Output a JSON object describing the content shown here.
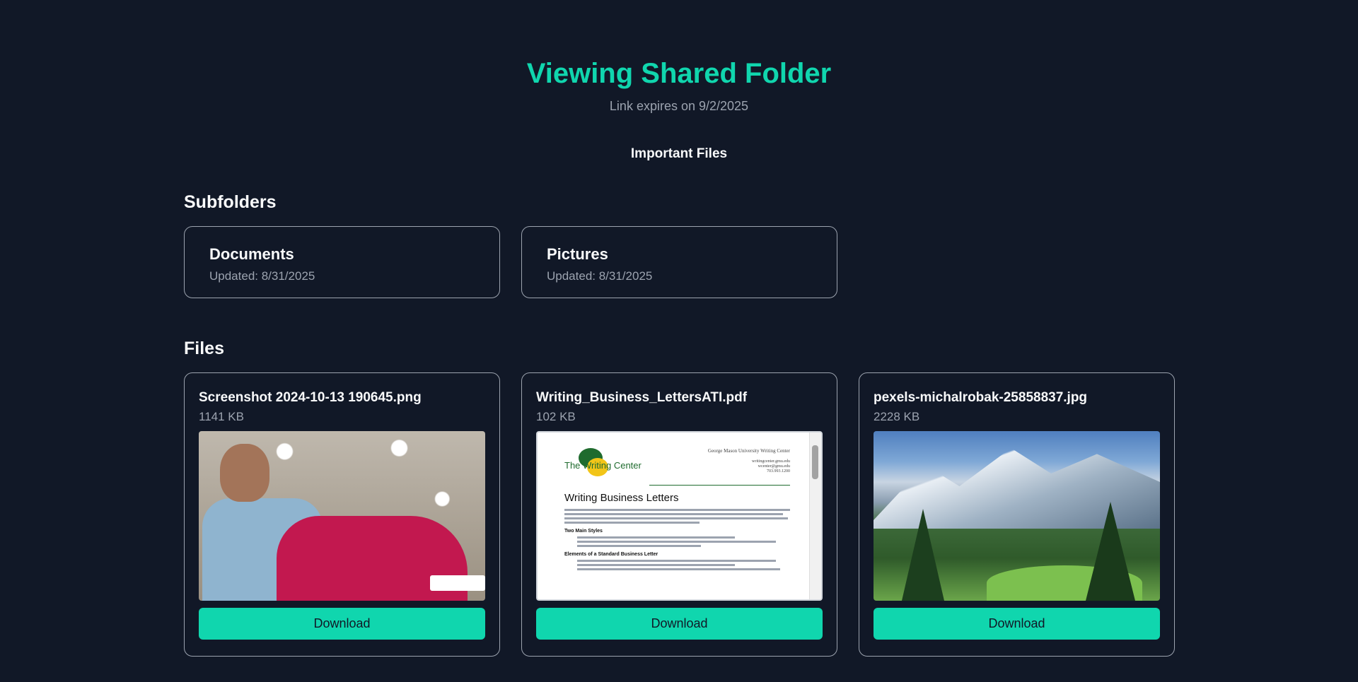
{
  "header": {
    "title": "Viewing Shared Folder",
    "expires": "Link expires on 9/2/2025",
    "folder_name": "Important Files"
  },
  "subfolders": {
    "heading": "Subfolders",
    "items": [
      {
        "name": "Documents",
        "updated": "Updated: 8/31/2025"
      },
      {
        "name": "Pictures",
        "updated": "Updated: 8/31/2025"
      }
    ]
  },
  "files": {
    "heading": "Files",
    "items": [
      {
        "name": "Screenshot 2024-10-13 190645.png",
        "size": "1141 KB",
        "download_label": "Download",
        "preview": "image"
      },
      {
        "name": "Writing_Business_LettersATI.pdf",
        "size": "102 KB",
        "download_label": "Download",
        "preview": "pdf"
      },
      {
        "name": "pexels-michalrobak-25858837.jpg",
        "size": "2228 KB",
        "download_label": "Download",
        "preview": "image"
      }
    ]
  },
  "pdf_preview": {
    "org": "George Mason University Writing Center",
    "org_contact": "writingcenter.gmu.edu\nwcenter@gmu.edu\n703.993.1200",
    "logo": "The Writing Center",
    "doc_title": "Writing Business Letters",
    "section1": "Two Main Styles",
    "section2": "Elements of a Standard Business Letter"
  },
  "colors": {
    "background": "#111827",
    "accent": "#10d6ae",
    "muted_text": "#9ca3af",
    "card_border": "#9ca3af"
  }
}
